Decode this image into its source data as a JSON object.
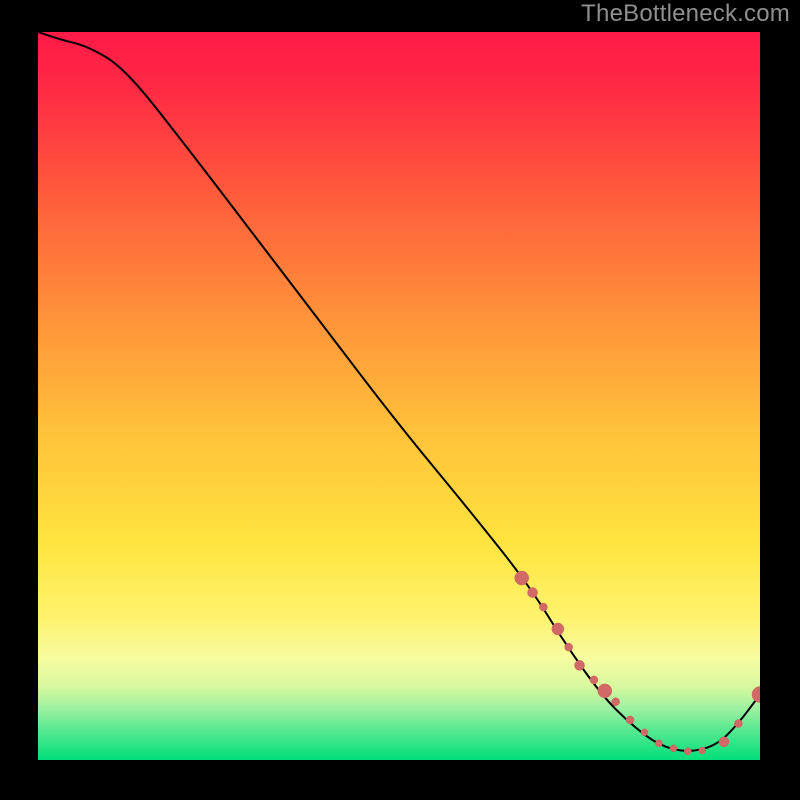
{
  "watermark": "TheBottleneck.com",
  "chart_data": {
    "type": "line",
    "title": "",
    "xlabel": "",
    "ylabel": "",
    "xlim": [
      0,
      100
    ],
    "ylim": [
      0,
      100
    ],
    "background_gradient": {
      "top": "#ff1a47",
      "mid": "#ffd23a",
      "bottom": "#00e07a"
    },
    "series": [
      {
        "name": "bottleneck-curve",
        "x": [
          0,
          3,
          7,
          12,
          20,
          30,
          40,
          50,
          60,
          68,
          73,
          78,
          82,
          86,
          90,
          94,
          97,
          100
        ],
        "y": [
          100,
          99,
          98,
          95,
          85,
          72,
          59,
          46,
          34,
          24,
          16,
          9,
          5,
          2,
          1,
          2,
          5,
          9
        ]
      }
    ],
    "markers": {
      "name": "highlighted-region",
      "x": [
        67,
        68.5,
        70,
        72,
        73.5,
        75,
        77,
        78.5,
        80,
        82,
        84,
        86,
        88,
        90,
        92,
        95,
        97,
        100
      ],
      "y": [
        25,
        23,
        21,
        18,
        15.5,
        13,
        11,
        9.5,
        8,
        5.5,
        3.8,
        2.3,
        1.6,
        1.2,
        1.3,
        2.5,
        5,
        9
      ],
      "r": [
        7,
        5,
        4,
        6,
        4,
        5,
        4,
        7,
        4,
        4,
        3.5,
        3.5,
        3.5,
        3.5,
        3.5,
        5,
        4,
        8
      ]
    },
    "annotation": {
      "text": "",
      "anchor_x": 85,
      "anchor_y": 0
    }
  }
}
